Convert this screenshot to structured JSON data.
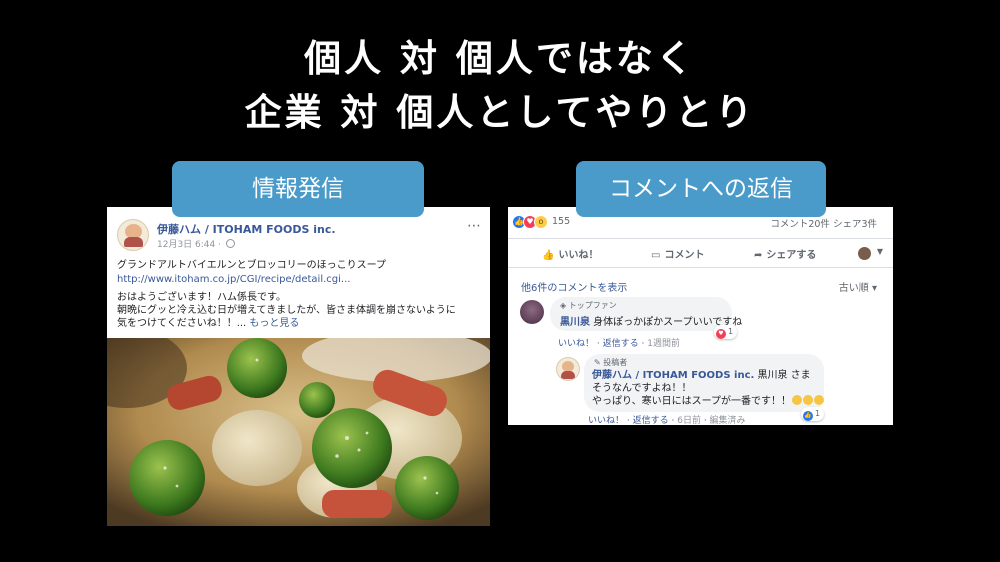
{
  "slide": {
    "title_line1": "個人 対 個人ではなく",
    "title_line2": "企業 対 個人としてやりとり",
    "label_left": "情報発信",
    "label_right": "コメントへの返信"
  },
  "post": {
    "page_name": "伊藤ハム / ITOHAM FOODS inc.",
    "date": "12月3日 6:44 · ",
    "more_icon": "⋯",
    "recipe_title": "グランドアルトバイエルンとブロッコリーのほっこりスープ",
    "link": "http://www.itoham.co.jp/CGI/recipe/detail.cgi...",
    "body_line1": "おはようございます！ハム係長です。",
    "body_line2": "朝晩にグッと冷え込む日が増えてきましたが、皆さま体調を崩さないように",
    "body_line3": "気をつけてくださいね！！... ",
    "see_more": "もっと見る"
  },
  "comments_panel": {
    "reaction_count": "155",
    "comment_stats": "コメント20件  シェア3件",
    "actions": {
      "like": "いいね！",
      "comment": "コメント",
      "share": "シェアする"
    },
    "prev_comments": "他6件のコメントを表示",
    "sort_order": "古い順 ▾",
    "comment1": {
      "badge": "トップファン",
      "author": "黒川泉",
      "text": " 身体ぽっかぽかスープいいですね",
      "reaction_count": "1",
      "like": "いいね！",
      "reply": "返信する",
      "time": "1週間前"
    },
    "comment2": {
      "badge": "投稿者",
      "author": "伊藤ハム / ITOHAM FOODS inc.",
      "mention": " 黒川泉 さま",
      "line2": "そうなんですよね！！",
      "line3": "やっぱり、寒い日にはスープが一番です！！",
      "reaction_count": "1",
      "like": "いいね！",
      "reply": "返信する",
      "time": "6日前",
      "edited": "編集済み"
    }
  },
  "colors": {
    "label_bg": "#4a9bc9",
    "fb_link": "#385898",
    "background": "#000000"
  },
  "icons": [
    "globe-icon",
    "more-icon",
    "like-icon",
    "comment-icon",
    "share-icon",
    "heart-icon",
    "emoji-icon"
  ]
}
